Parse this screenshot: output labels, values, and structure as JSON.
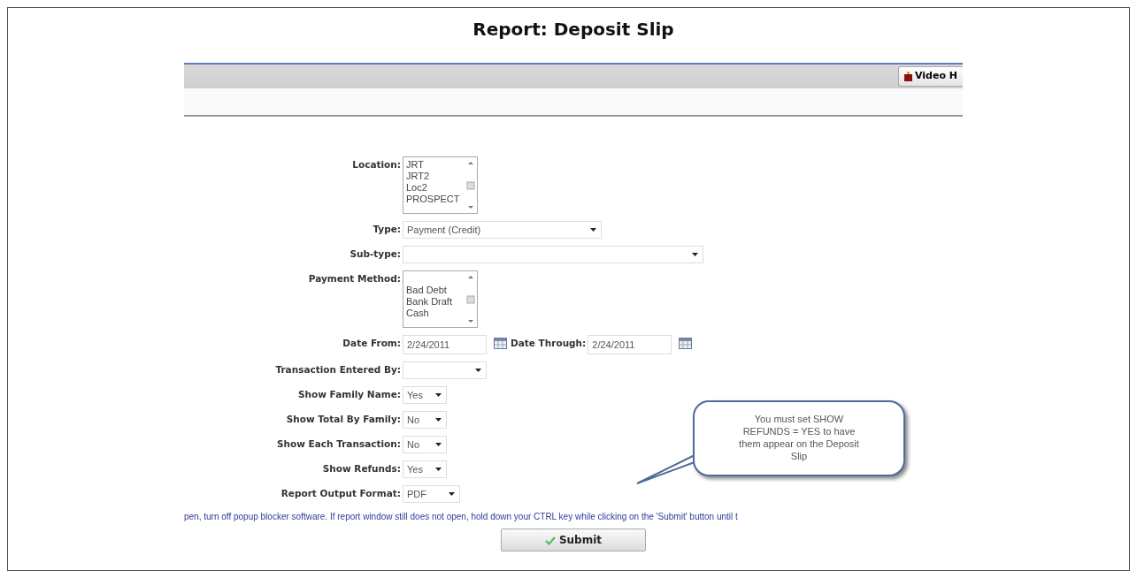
{
  "title": "Report: Deposit Slip",
  "toolbar": {
    "button": "Video H"
  },
  "fields": [
    {
      "kind": "listbox",
      "label": "Location:",
      "options": [
        "JRT",
        "JRT2",
        "Loc2",
        "PROSPECT"
      ]
    },
    {
      "kind": "select",
      "label": "Type:",
      "value": "Payment (Credit)"
    },
    {
      "kind": "select",
      "label": "Sub-type:"
    },
    {
      "kind": "listbox",
      "label": "Payment Method:",
      "options": [
        "Bad Debt",
        "Bank Draft",
        "Cash"
      ]
    },
    {
      "kind": "dates",
      "label": "Date From:",
      "value": "2/24/2011",
      "second_label": "Date Through:",
      "second_value": "2/24/2011"
    },
    {
      "kind": "select",
      "label": "Transaction Entered By:"
    },
    {
      "kind": "select",
      "label": "Show Family Name:",
      "value": "Yes"
    },
    {
      "kind": "select",
      "label": "Show Total By Family:",
      "value": "No"
    },
    {
      "kind": "select",
      "label": "Show Each Transaction:",
      "value": "No"
    },
    {
      "kind": "select",
      "label": "Show Refunds:",
      "value": "Yes"
    },
    {
      "kind": "select",
      "label": "Report Output Format:",
      "value": "PDF"
    }
  ],
  "note": "pen, turn off popup blocker software. If report window still does not open, hold down your CTRL key while clicking on the 'Submit' button until t",
  "submit": "Submit",
  "callout": "You must set SHOW REFUNDS = YES to have them appear on the Deposit Slip"
}
